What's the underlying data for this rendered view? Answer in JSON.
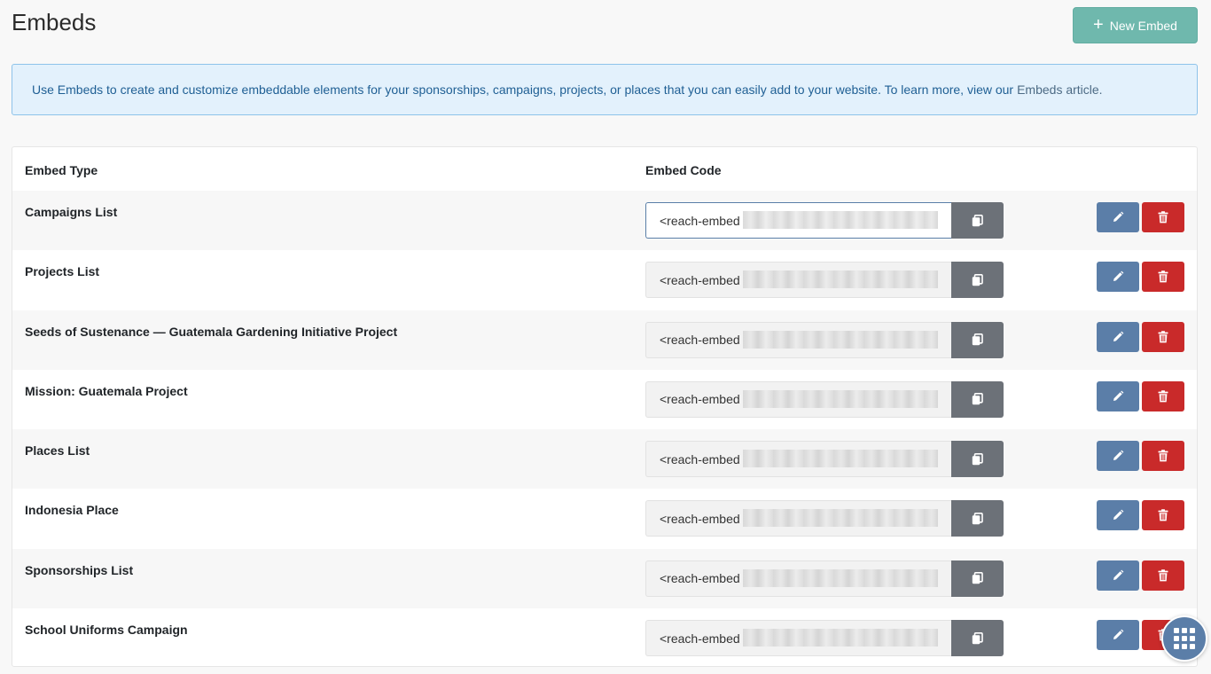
{
  "page": {
    "title": "Embeds"
  },
  "header": {
    "new_embed_label": "New Embed"
  },
  "alert": {
    "text": "Use Embeds to create and customize embeddable elements for your sponsorships, campaigns, projects, or places that you can easily add to your website. To learn more, view our",
    "link_text": "Embeds article."
  },
  "table": {
    "columns": {
      "type": "Embed Type",
      "code": "Embed Code"
    },
    "rows": [
      {
        "name": "Campaigns List",
        "code": "<reach-embed",
        "focused": true
      },
      {
        "name": "Projects List",
        "code": "<reach-embed"
      },
      {
        "name": "Seeds of Sustenance — Guatemala Gardening Initiative Project",
        "code": "<reach-embed"
      },
      {
        "name": "Mission: Guatemala Project",
        "code": "<reach-embed"
      },
      {
        "name": "Places List",
        "code": "<reach-embed"
      },
      {
        "name": "Indonesia Place",
        "code": "<reach-embed"
      },
      {
        "name": "Sponsorships List",
        "code": "<reach-embed"
      },
      {
        "name": "School Uniforms Campaign",
        "code": "<reach-embed"
      }
    ]
  },
  "icons": {
    "new": "plus-icon",
    "copy": "copy-icon",
    "edit": "pencil-icon",
    "delete": "trash-icon",
    "apps": "grid-icon"
  },
  "colors": {
    "primary_teal": "#6fb8ad",
    "edit_blue": "#5b7ea8",
    "delete_red": "#c92a2a",
    "copy_gray": "#6c7178",
    "alert_bg": "#e3f1fc",
    "alert_text": "#1f5f94"
  }
}
